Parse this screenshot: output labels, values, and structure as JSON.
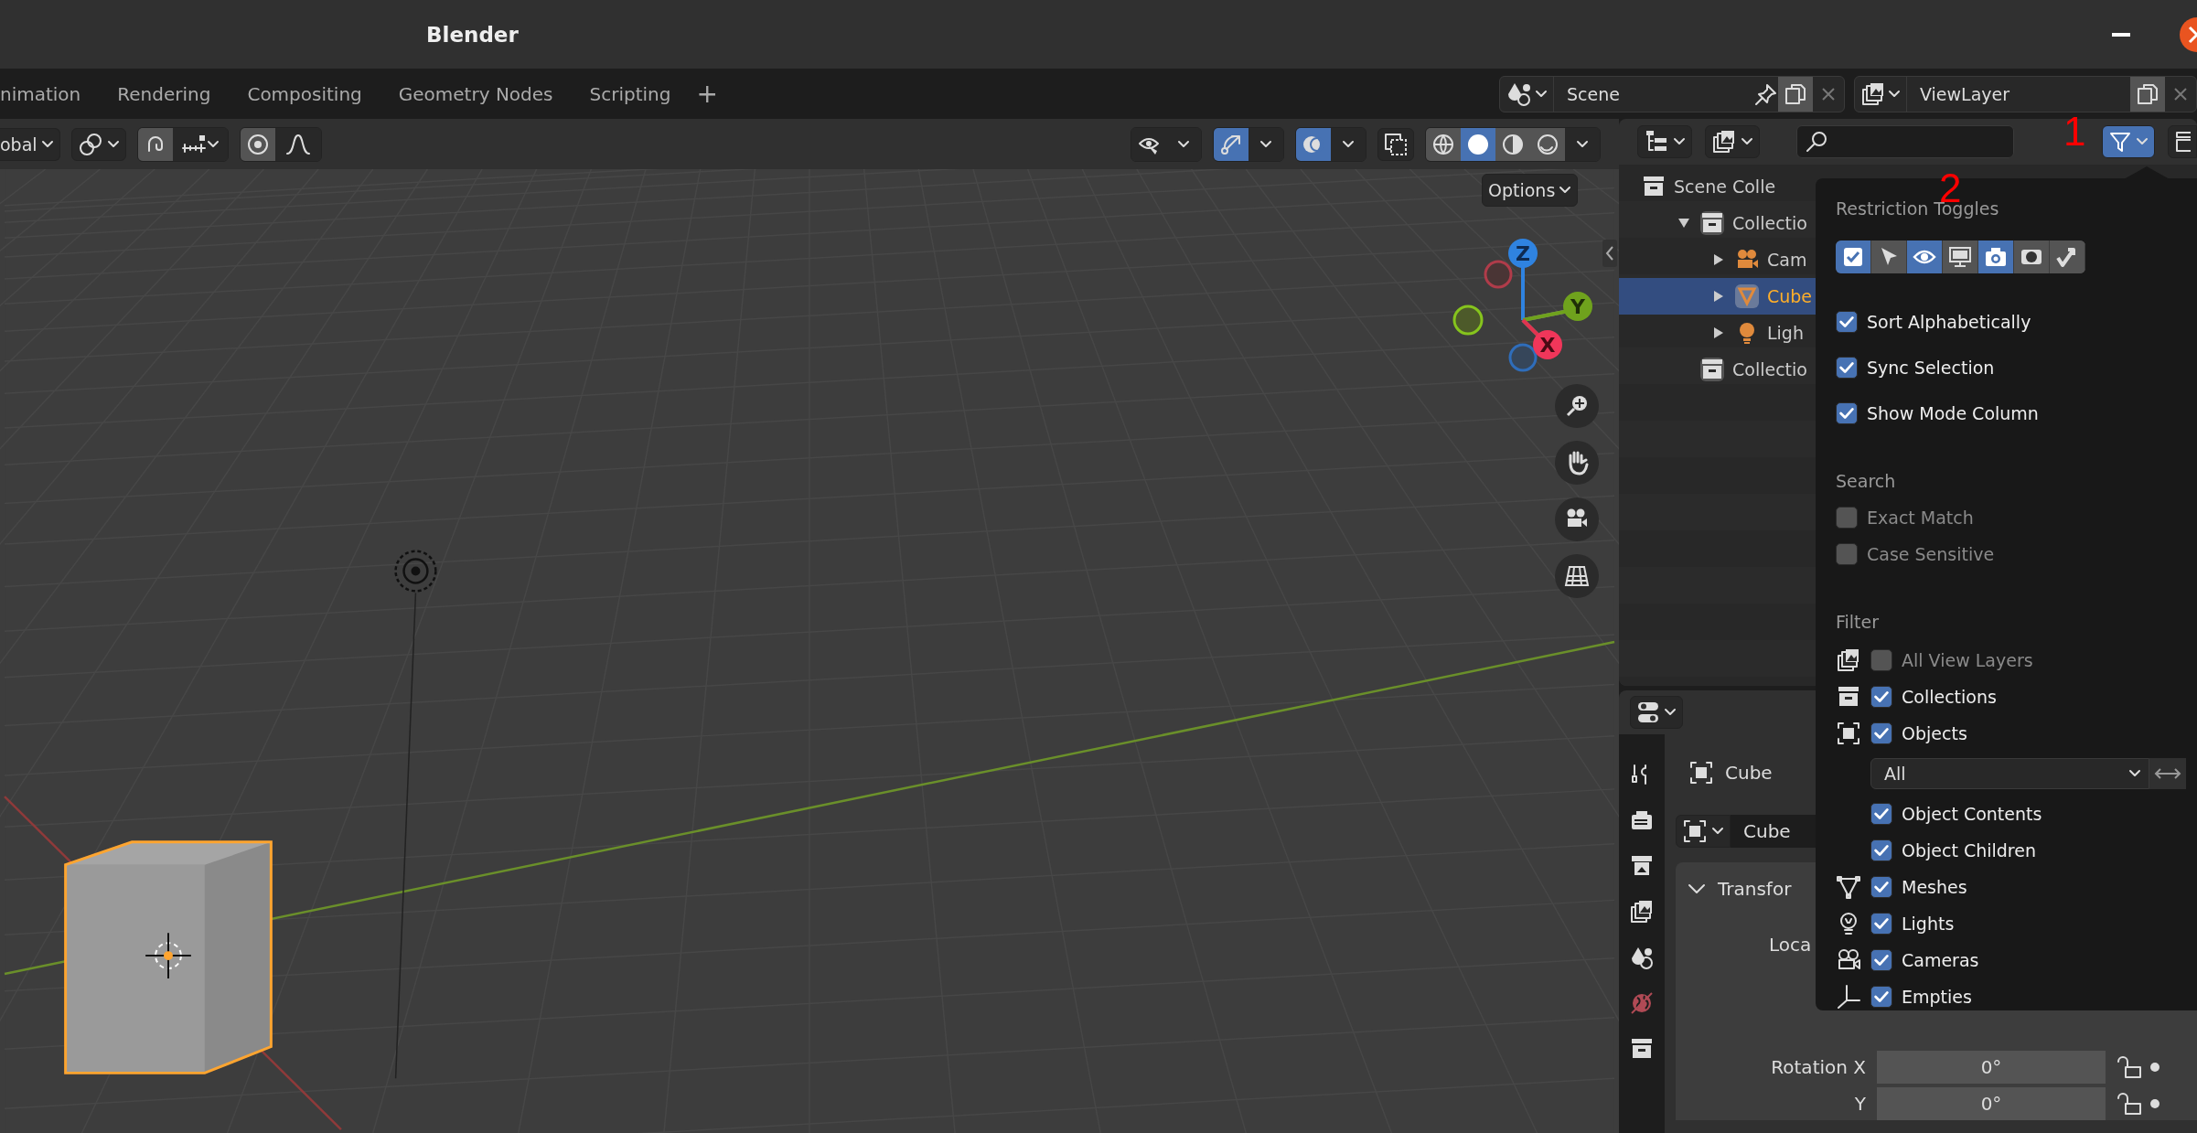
{
  "window": {
    "title": "Blender"
  },
  "workspace_tabs": [
    {
      "label": "nimation",
      "selected": false
    },
    {
      "label": "Rendering",
      "selected": false
    },
    {
      "label": "Compositing",
      "selected": false
    },
    {
      "label": "Geometry Nodes",
      "selected": false
    },
    {
      "label": "Scripting",
      "selected": false
    }
  ],
  "add_workspace": "+",
  "scene": {
    "value": "Scene"
  },
  "view_layer": {
    "value": "ViewLayer"
  },
  "viewport": {
    "orientation": "obal",
    "options": "Options",
    "toggles": [
      {
        "kind": "visibility",
        "on": false
      },
      {
        "kind": "gizmo",
        "on": true
      },
      {
        "kind": "overlay",
        "on": true
      }
    ],
    "shading": [
      {
        "kind": "wireframe",
        "selected": false
      },
      {
        "kind": "solid",
        "selected": true
      },
      {
        "kind": "material",
        "selected": false
      },
      {
        "kind": "rendered",
        "selected": false
      }
    ],
    "gizmo_labels": [
      "Z",
      "Y",
      "X"
    ]
  },
  "outliner": {
    "items": [
      {
        "label": "Scene Colle",
        "kind": "scene",
        "selected": false,
        "children": [
          {
            "label": "Collectio",
            "kind": "collection",
            "selected": false,
            "expanded": true,
            "children": [
              {
                "label": "Cam",
                "kind": "camera",
                "selected": false,
                "expanded": false
              },
              {
                "label": "Cube",
                "kind": "mesh",
                "selected": true,
                "expanded": false
              },
              {
                "label": "Ligh",
                "kind": "light",
                "selected": false,
                "expanded": false
              }
            ]
          },
          {
            "label": "Collectio",
            "kind": "collection",
            "selected": false
          }
        ]
      }
    ]
  },
  "filter_popup": {
    "restriction_title": "Restriction Toggles",
    "restriction_toggles": [
      {
        "kind": "checkbox",
        "on": true
      },
      {
        "kind": "select",
        "on": false
      },
      {
        "kind": "eye",
        "on": true
      },
      {
        "kind": "monitor",
        "on": false
      },
      {
        "kind": "camera",
        "on": true
      },
      {
        "kind": "holdout",
        "on": false
      },
      {
        "kind": "indirect",
        "on": false
      }
    ],
    "options": [
      {
        "label": "Sort Alphabetically",
        "checked": true
      },
      {
        "label": "Sync Selection",
        "checked": true
      },
      {
        "label": "Show Mode Column",
        "checked": true
      }
    ],
    "search_title": "Search",
    "search_options": [
      {
        "label": "Exact Match",
        "checked": false
      },
      {
        "label": "Case Sensitive",
        "checked": false
      }
    ],
    "filter_title": "Filter",
    "filters": [
      {
        "kind": "view_layers",
        "label": "All View Layers",
        "checked": false
      },
      {
        "kind": "collections",
        "label": "Collections",
        "checked": true
      },
      {
        "kind": "objects",
        "label": "Objects",
        "checked": true
      },
      {
        "kind": "dropdown",
        "value": "All"
      },
      {
        "kind": "plain",
        "label": "Object Contents",
        "checked": true
      },
      {
        "kind": "plain",
        "label": "Object Children",
        "checked": true
      },
      {
        "kind": "meshes",
        "label": "Meshes",
        "checked": true
      },
      {
        "kind": "lights",
        "label": "Lights",
        "checked": true
      },
      {
        "kind": "cameras",
        "label": "Cameras",
        "checked": true
      },
      {
        "kind": "empties",
        "label": "Empties",
        "checked": true
      }
    ]
  },
  "annotations": [
    {
      "text": "1"
    },
    {
      "text": "2"
    }
  ],
  "properties": {
    "object_name": "Cube",
    "data_name": "Cube",
    "panel_title": "Transfor",
    "panel_expanded": true,
    "location_label": "Loca",
    "rotation": [
      {
        "label": "Rotation X",
        "value": "0°"
      },
      {
        "label": "Y",
        "value": "0°"
      }
    ]
  }
}
